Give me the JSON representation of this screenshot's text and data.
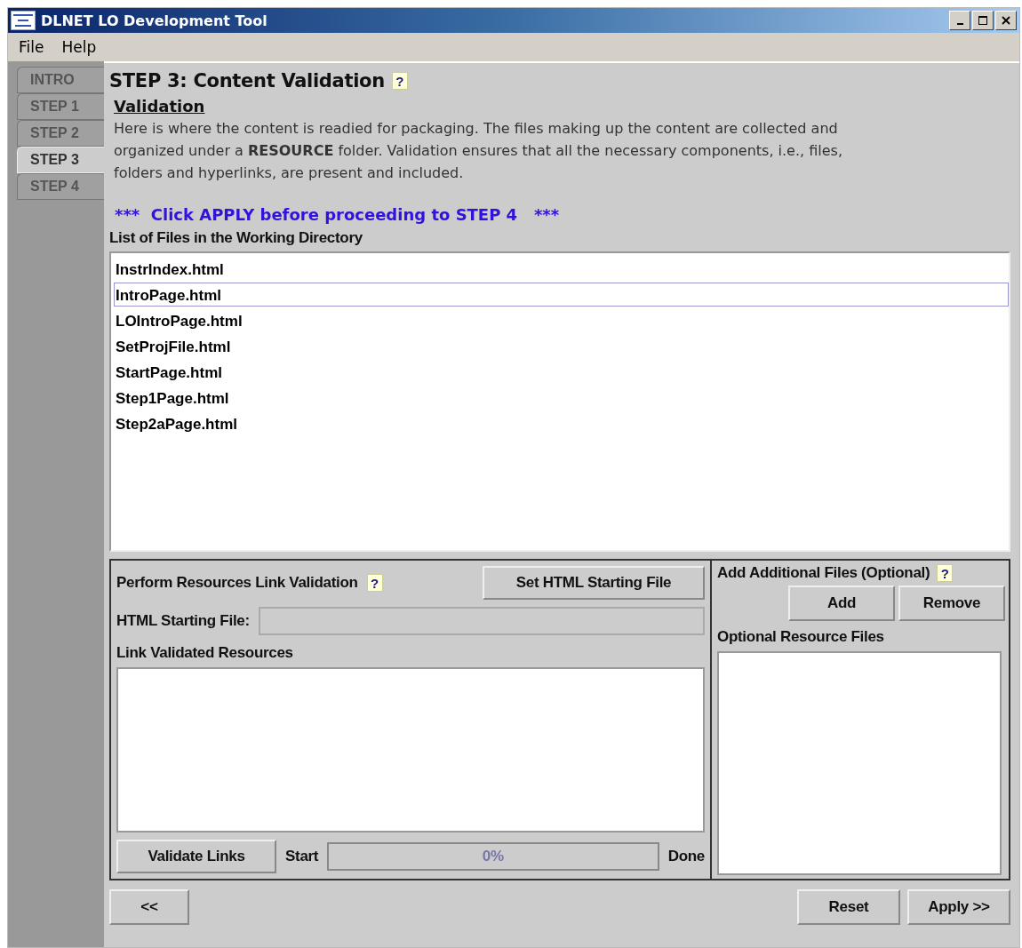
{
  "window": {
    "title": "DLNET LO Development Tool"
  },
  "menu": [
    "File",
    "Help"
  ],
  "tabs": [
    {
      "label": "INTRO",
      "selected": false
    },
    {
      "label": "STEP 1",
      "selected": false
    },
    {
      "label": "STEP 2",
      "selected": false
    },
    {
      "label": "STEP 3",
      "selected": true
    },
    {
      "label": "STEP 4",
      "selected": false
    }
  ],
  "heading": "STEP 3: Content Validation",
  "heading_help": "?",
  "section_title": "Validation",
  "description": "Here is where the content is readied for packaging. The files making up the content are collected and organized under a **RESOURCE** folder. Validation ensures that all the necessary components, i.e., files, folders and hyperlinks, are present and included.",
  "notice": "***  Click APPLY before proceeding to STEP 4   ***",
  "files_label": "List of Files in the Working Directory",
  "files": [
    {
      "name": "InstrIndex.html",
      "selected": false
    },
    {
      "name": "IntroPage.html",
      "selected": true
    },
    {
      "name": "LOIntroPage.html",
      "selected": false
    },
    {
      "name": "SetProjFile.html",
      "selected": false
    },
    {
      "name": "StartPage.html",
      "selected": false
    },
    {
      "name": "Step1Page.html",
      "selected": false
    },
    {
      "name": "Step2aPage.html",
      "selected": false
    }
  ],
  "link_validation": {
    "title": "Perform Resources Link Validation",
    "help": "?",
    "set_button": "Set HTML Starting File",
    "start_file_label": "HTML Starting File:",
    "resources_label": "Link Validated Resources",
    "validate_button": "Validate Links",
    "start_label": "Start",
    "progress": {
      "level": 0,
      "reading": "0%"
    },
    "done_label": "Done"
  },
  "additional_files": {
    "title": "Add Additional Files (Optional)",
    "help": "?",
    "add_button": "Add",
    "remove_button": "Remove",
    "list_label": "Optional Resource Files"
  },
  "footer": {
    "back_button": "<<",
    "reset_button": "Reset",
    "apply_button": "Apply >>"
  }
}
